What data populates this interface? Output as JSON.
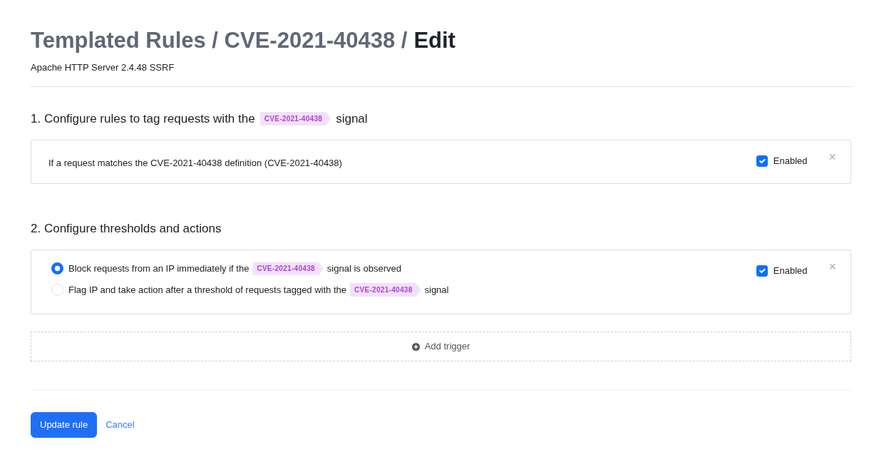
{
  "title": [
    {
      "text": "Templated Rules / CVE-2021-40438 /",
      "current": false
    },
    {
      "text": "Edit",
      "current": true
    }
  ],
  "subtitle": "Apache HTTP Server 2.4.48 SSRF",
  "sections": [
    {
      "heading": [
        {
          "kind": "text",
          "text": "1. Configure rules to tag requests with the"
        },
        {
          "kind": "tag",
          "text": "CVE-2021-40438"
        },
        {
          "kind": "text",
          "text": "signal"
        }
      ],
      "card": {
        "kind": "rule",
        "text": "If a request matches the CVE-2021-40438 definition (CVE-2021-40438)",
        "enabled": {
          "label": "Enabled",
          "checked": true
        },
        "close": "×"
      }
    },
    {
      "heading": [
        {
          "kind": "text",
          "text": "2. Configure thresholds and actions"
        }
      ],
      "card": {
        "kind": "options",
        "options": [
          {
            "selected": true,
            "parts": [
              {
                "kind": "text",
                "text": "Block requests from an IP immediately if the"
              },
              {
                "kind": "tag",
                "text": "CVE-2021-40438"
              },
              {
                "kind": "text",
                "text": "signal is observed"
              }
            ]
          },
          {
            "selected": false,
            "parts": [
              {
                "kind": "text",
                "text": "Flag IP and take action after a threshold of requests tagged with the"
              },
              {
                "kind": "tag",
                "text": "CVE-2021-40438"
              },
              {
                "kind": "text",
                "text": "signal"
              }
            ]
          }
        ],
        "enabled": {
          "label": "Enabled",
          "checked": true
        },
        "close": "×"
      },
      "add_trigger": "Add trigger"
    }
  ],
  "actions": {
    "primary": "Update rule",
    "secondary": "Cancel"
  }
}
